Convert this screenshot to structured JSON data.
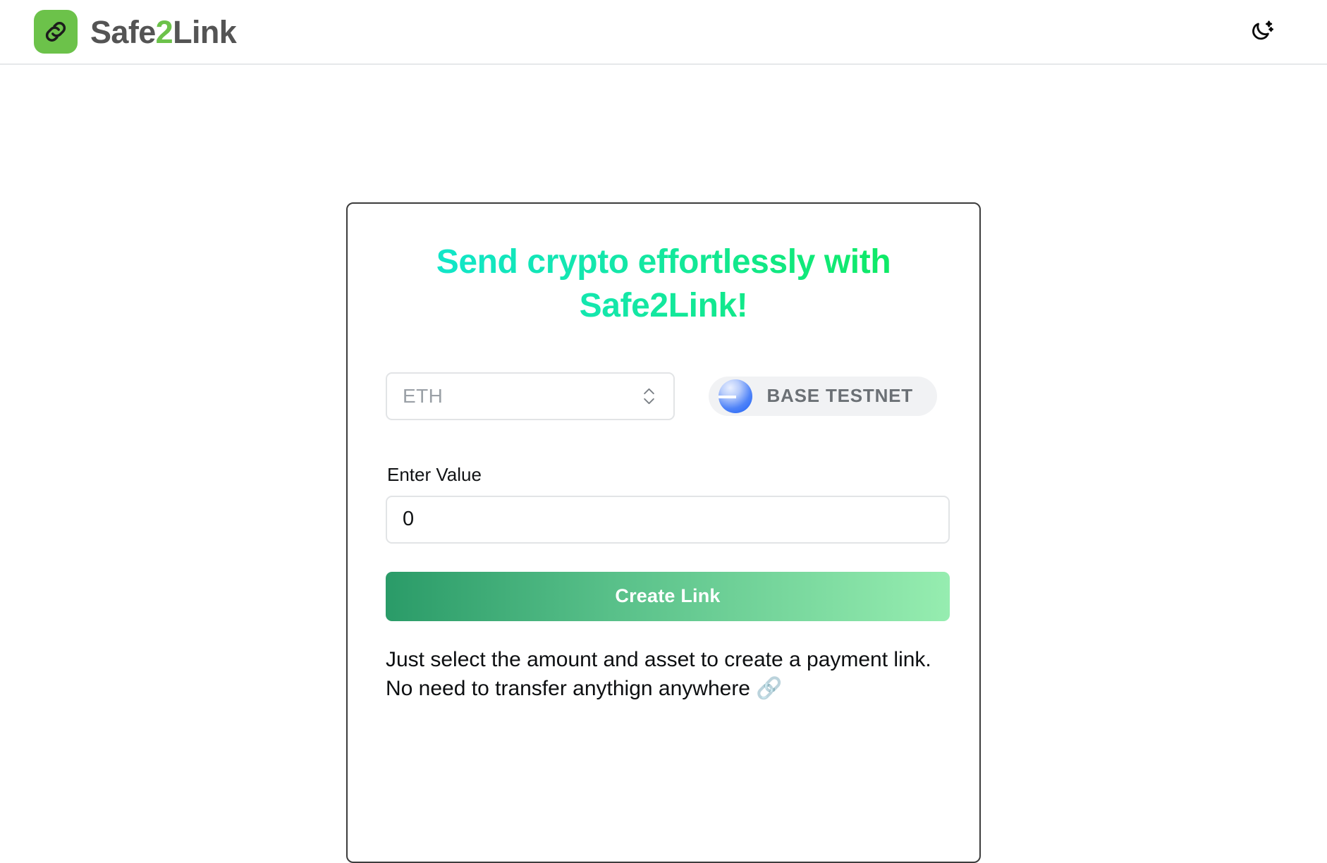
{
  "header": {
    "brand": {
      "part_one": "Safe",
      "accent": "2",
      "part_two": "Link",
      "logo_icon": "chain-link-icon",
      "logo_bg": "#6cc24a",
      "text_color": "#545454",
      "accent_color": "#6cc24a"
    },
    "theme_toggle": {
      "icon": "moon-stars-icon",
      "label": "Toggle dark mode"
    }
  },
  "card": {
    "headline": "Send crypto effortlessly with Safe2Link!",
    "headline_gradient_from": "#10e5d2",
    "headline_gradient_to": "#0eea59",
    "asset_select": {
      "icon": "chevron-updown-icon",
      "selected": "ETH",
      "options": [
        "ETH"
      ]
    },
    "network_badge": {
      "label": "BASE TESTNET",
      "icon": "base-network-icon",
      "icon_color": "#1b5ff5",
      "bg": "#f1f2f4"
    },
    "value_field": {
      "label": "Enter Value",
      "value": "0",
      "placeholder": "0"
    },
    "create_button": {
      "label": "Create Link",
      "gradient_from": "#2a9b68",
      "gradient_to": "#96edb0"
    },
    "blurb": "Just select the amount and asset to create a payment link. No need to transfer anythign anywhere ",
    "blurb_emoji": "🔗"
  }
}
